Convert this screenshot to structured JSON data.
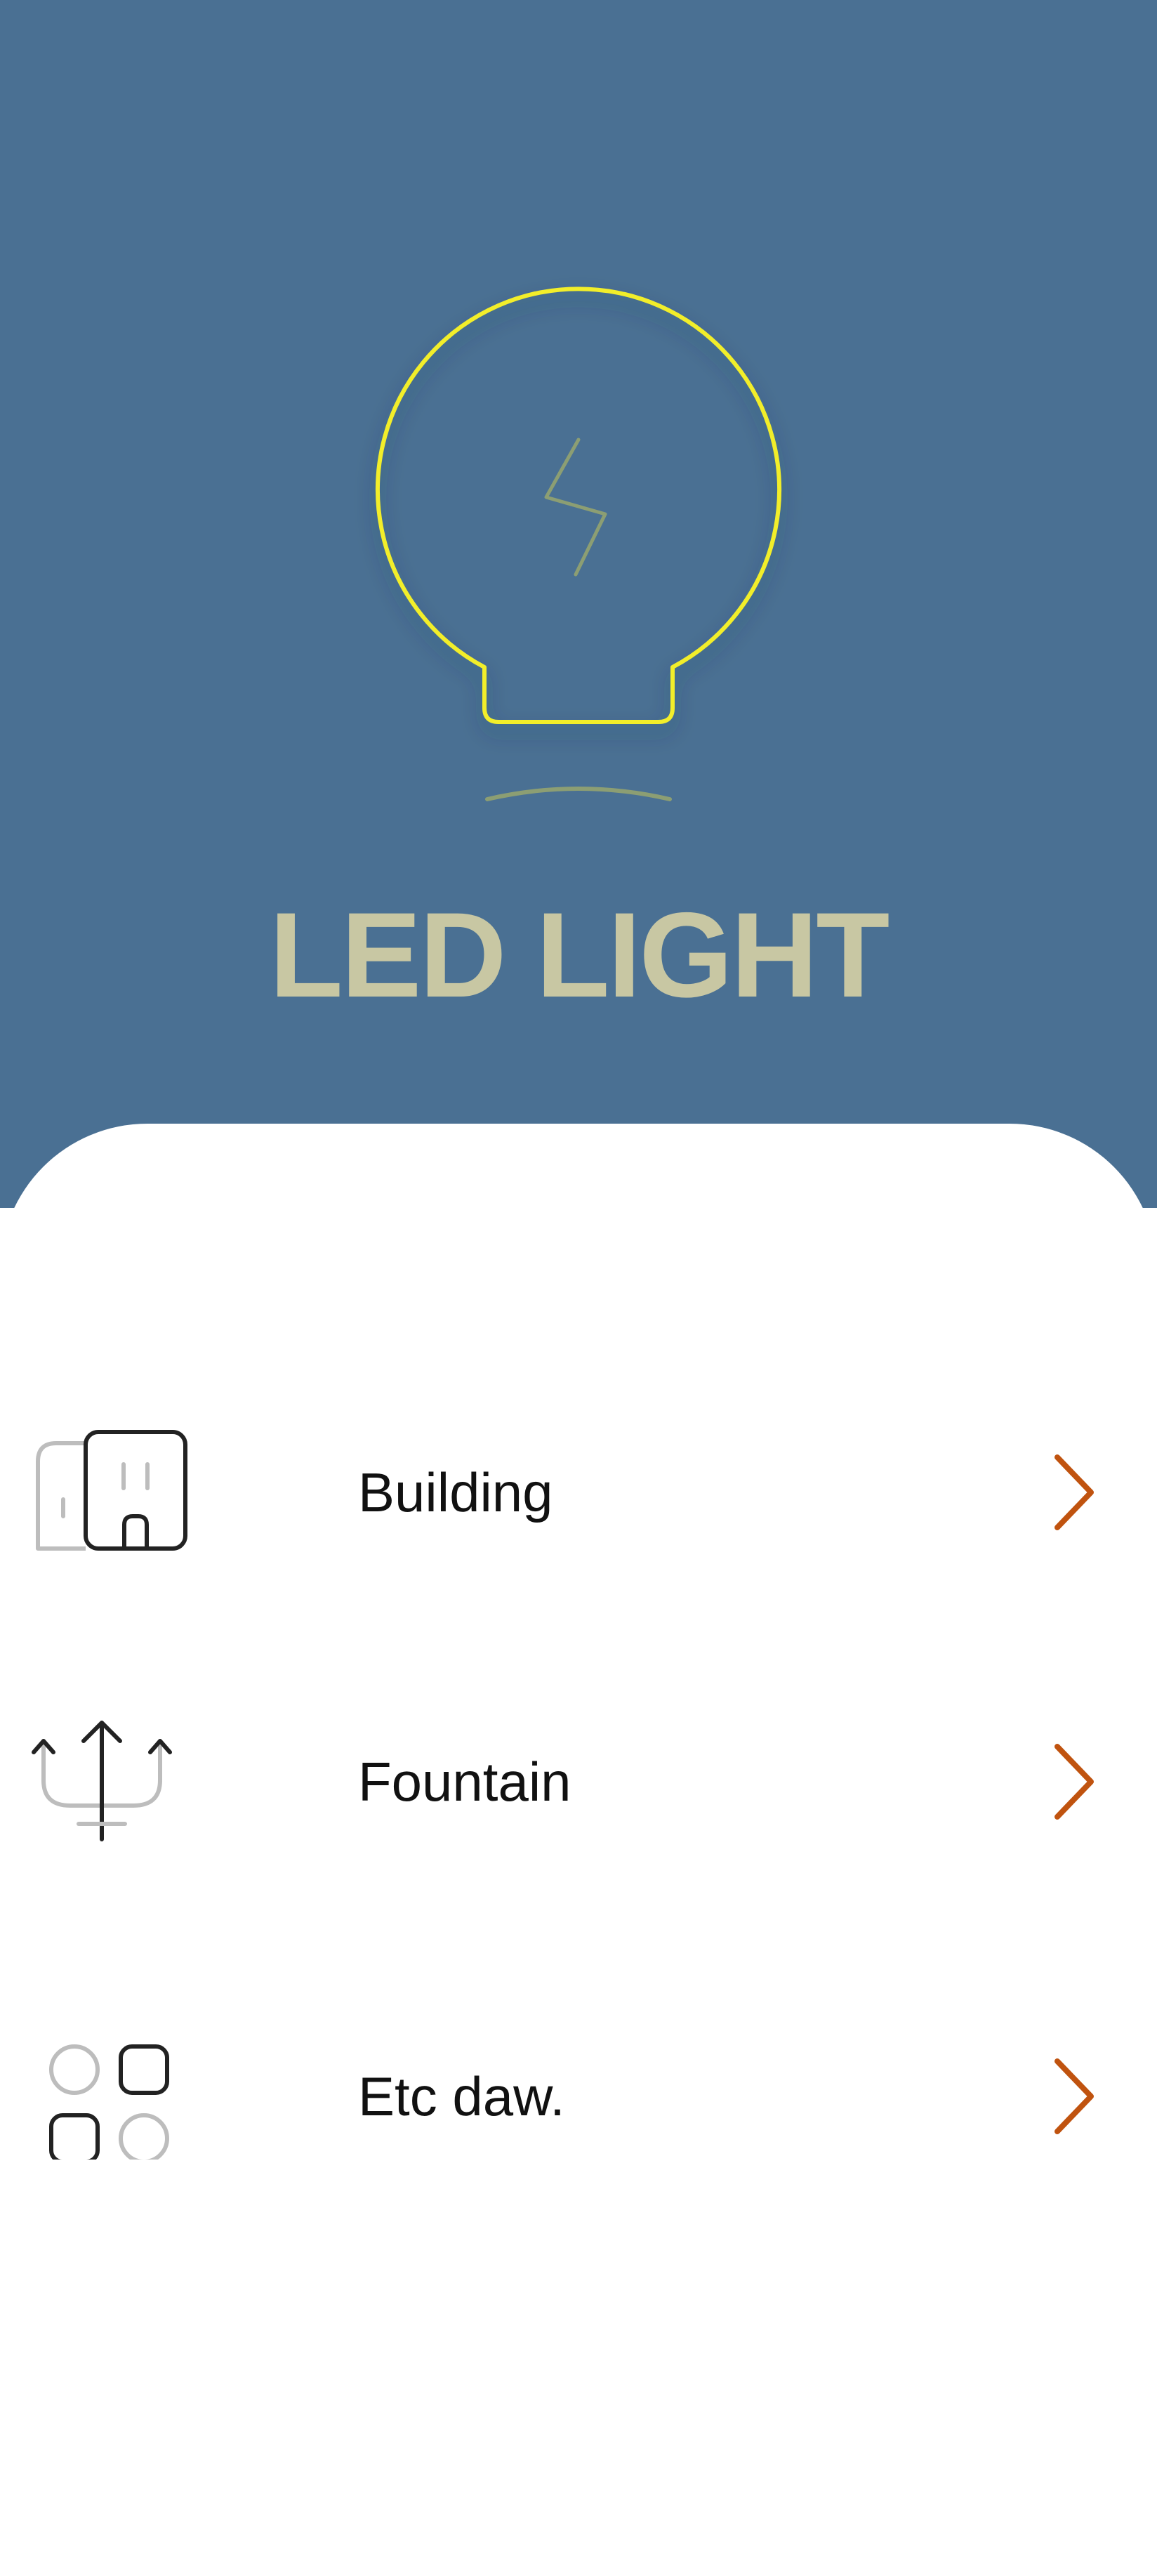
{
  "hero": {
    "title": "LED LIGHT",
    "background_color": "#4A7093",
    "title_color": "#C8C7A3",
    "bulb_outline_color": "#F2EE2C",
    "bulb_icon": "lightbulb-icon"
  },
  "menu": {
    "chevron_color": "#C0530F",
    "items": [
      {
        "label": "Building",
        "icon": "building-icon"
      },
      {
        "label": "Fountain",
        "icon": "fountain-icon"
      },
      {
        "label": "Etc daw.",
        "icon": "apps-icon"
      }
    ]
  }
}
